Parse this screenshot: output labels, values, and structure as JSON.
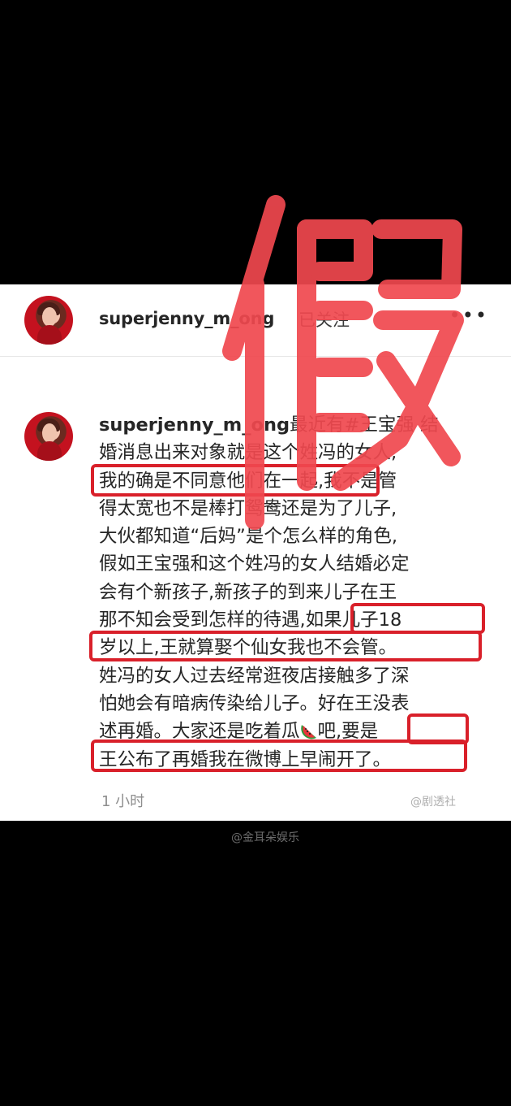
{
  "post": {
    "username": "superjenny_m_ong",
    "follow_status": "已关注",
    "more_icon": "more-icon"
  },
  "comment": {
    "username": "superjenny_m_ong",
    "lines": [
      "最近有#王宝强 结",
      "婚消息出来对象就是这个姓冯的女人,",
      "我的确是不同意他们在一起,我不是管",
      "得太宽也不是棒打鸳鸯还是为了儿子,",
      "大伙都知道“后妈”是个怎么样的角色,",
      "假如王宝强和这个姓冯的女人结婚必定",
      "会有个新孩子,新孩子的到来儿子在王",
      "那不知会受到怎样的待遇,如果儿子18",
      "岁以上,王就算娶个仙女我也不会管。",
      "姓冯的女人过去经常逛夜店接触多了深",
      "怕她会有暗病传染给儿子。好在王没表",
      "述再婚。大家还是吃着瓜",
      "吧,要是",
      "王公布了再婚我在微博上早闹开了。"
    ],
    "emoji": "watermelon",
    "time": "1 小时"
  },
  "overlay": {
    "stamp_text": "假",
    "stamp_color": "#f0484f",
    "highlight_color": "#d9202a"
  },
  "watermarks": {
    "bottom_right": "@剧透社",
    "center": "@金耳朵娱乐"
  }
}
